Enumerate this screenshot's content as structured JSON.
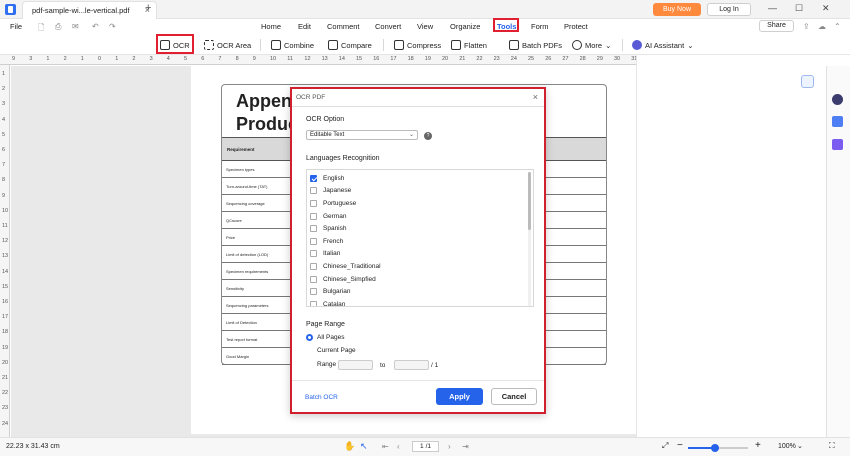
{
  "window": {
    "tab_title": "pdf-sample-wi...le-vertical.pdf",
    "new_tab": "+",
    "buy_now": "Buy Now",
    "login": "Log In",
    "minimize": "—",
    "maximize": "☐",
    "close": "✕"
  },
  "menubar": {
    "file": "File",
    "items": [
      "Home",
      "Edit",
      "Comment",
      "Convert",
      "View",
      "Organize",
      "Tools",
      "Form",
      "Protect"
    ],
    "share": "Share"
  },
  "toolbar": {
    "ocr": "OCR",
    "ocr_area": "OCR Area",
    "combine": "Combine",
    "compare": "Compare",
    "compress": "Compress",
    "flatten": "Flatten",
    "batch_pdfs": "Batch PDFs",
    "more": "More",
    "ai_assistant": "AI Assistant"
  },
  "ruler": {
    "top": [
      "9",
      "3",
      "1",
      "2",
      "1",
      "0",
      "1",
      "2",
      "3",
      "4",
      "5",
      "6",
      "7",
      "8",
      "9",
      "10",
      "11",
      "12",
      "13",
      "14",
      "15",
      "16",
      "17",
      "18",
      "19",
      "20",
      "21",
      "22",
      "23",
      "24",
      "25",
      "26",
      "27",
      "28",
      "29",
      "30",
      "31"
    ],
    "left": [
      "1",
      "2",
      "3",
      "4",
      "5",
      "6",
      "7",
      "8",
      "9",
      "10",
      "11",
      "12",
      "13",
      "14",
      "15",
      "16",
      "17",
      "18",
      "19",
      "20",
      "21",
      "22",
      "23",
      "24"
    ]
  },
  "document": {
    "title_line1": "Appen",
    "title_line2": "Produc",
    "table_header": "Requirement",
    "rows": [
      "Specimen types",
      "Turn-around-time (TAT)",
      "Sequencing coverage",
      "QCscore",
      "Price",
      "Limit of detection (LOD)",
      "Specimen requirements",
      "Sensitivity",
      "Sequencing parameters",
      "Limit of Detection",
      "Test report format",
      "Good Margin"
    ]
  },
  "dialog": {
    "title": "OCR PDF",
    "ocr_option_label": "OCR Option",
    "ocr_option_value": "Editable Text",
    "languages_label": "Languages Recognition",
    "languages": [
      {
        "name": "English",
        "checked": true
      },
      {
        "name": "Japanese",
        "checked": false
      },
      {
        "name": "Portuguese",
        "checked": false
      },
      {
        "name": "German",
        "checked": false
      },
      {
        "name": "Spanish",
        "checked": false
      },
      {
        "name": "French",
        "checked": false
      },
      {
        "name": "Italian",
        "checked": false
      },
      {
        "name": "Chinese_Traditional",
        "checked": false
      },
      {
        "name": "Chinese_Simpfied",
        "checked": false
      },
      {
        "name": "Bulgarian",
        "checked": false
      },
      {
        "name": "Catalan",
        "checked": false
      }
    ],
    "page_range_label": "Page Range",
    "all_pages": "All Pages",
    "current_page": "Current Page",
    "range": "Range",
    "range_to": "to",
    "range_total": "/ 1",
    "batch_ocr": "Batch OCR",
    "apply": "Apply",
    "cancel": "Cancel",
    "close": "×"
  },
  "statusbar": {
    "dimensions": "22.23 x 31.43 cm",
    "page_current": "1",
    "page_total": "/1",
    "zoom": "100%"
  },
  "colors": {
    "accent": "#2563eb",
    "highlight_border": "#e02030",
    "buy_now": "#ff8a3d"
  },
  "zoom_level": 0.45
}
